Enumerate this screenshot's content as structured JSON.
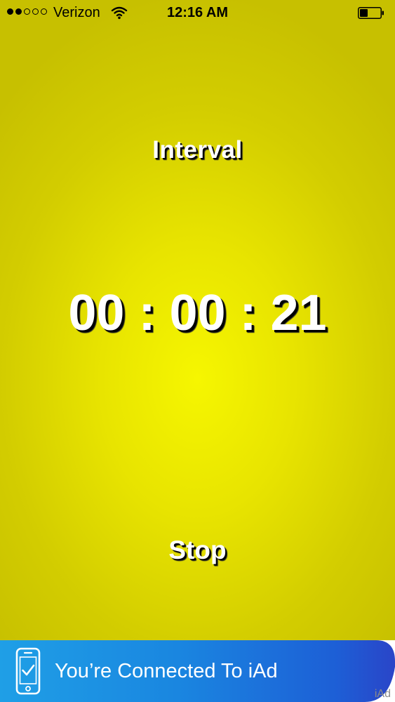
{
  "status_bar": {
    "carrier": "Verizon",
    "time": "12:16 AM",
    "signal_bars_filled": 2,
    "signal_bars_total": 5,
    "wifi_icon": "wifi-icon",
    "battery_icon": "battery-icon"
  },
  "main": {
    "mode_label": "Interval",
    "timer": "00 : 00 : 21",
    "stop_label": "Stop"
  },
  "ad": {
    "text": "You’re Connected To iAd",
    "brand": "iAd",
    "icon": "phone-check-icon"
  },
  "colors": {
    "background": "#e8e400",
    "ad_blue": "#1a86e0",
    "text": "#ffffff"
  }
}
